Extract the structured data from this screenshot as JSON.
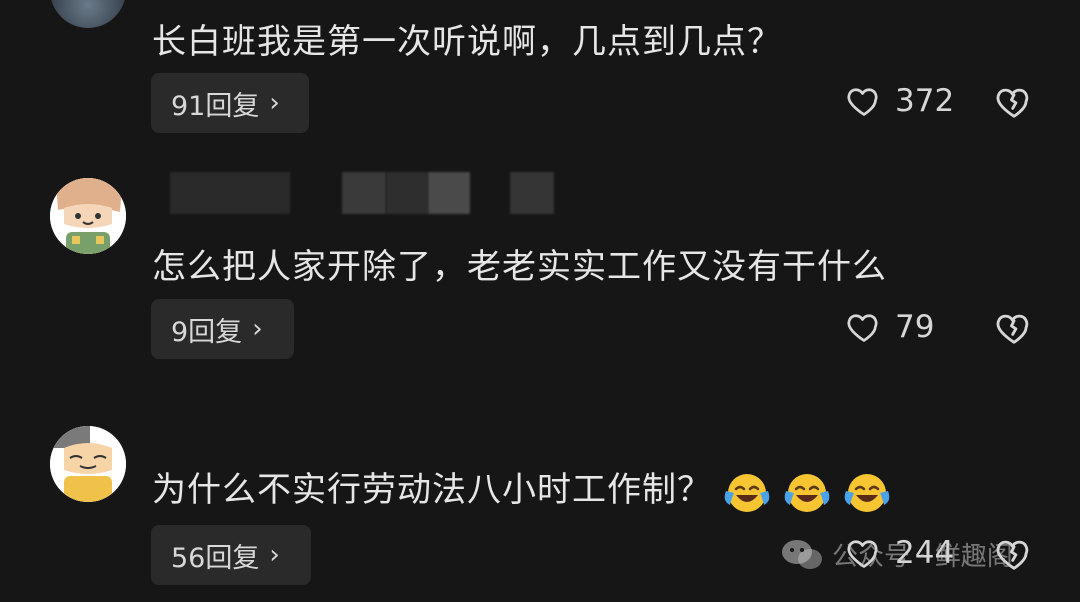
{
  "comments": [
    {
      "text": "长白班我是第一次听说啊，几点到几点？",
      "reply_label": "91回复",
      "likes": "372"
    },
    {
      "text": "怎么把人家开除了，老老实实工作又没有干什么",
      "reply_label": "9回复",
      "likes": "79"
    },
    {
      "text": "为什么不实行劳动法八小时工作制？",
      "reply_label": "56回复",
      "likes": "244"
    }
  ],
  "watermark": {
    "text": "公众号 · 鲜趣阁"
  },
  "icons": {
    "like": "heart-outline-icon",
    "dislike": "broken-heart-icon",
    "reply_chevron": "chevron-right-icon",
    "emoji": "laughing-crying-emoji-icon"
  },
  "colors": {
    "background": "#161616",
    "pill_background": "#2a2a2a",
    "text": "#e6e6e6"
  }
}
